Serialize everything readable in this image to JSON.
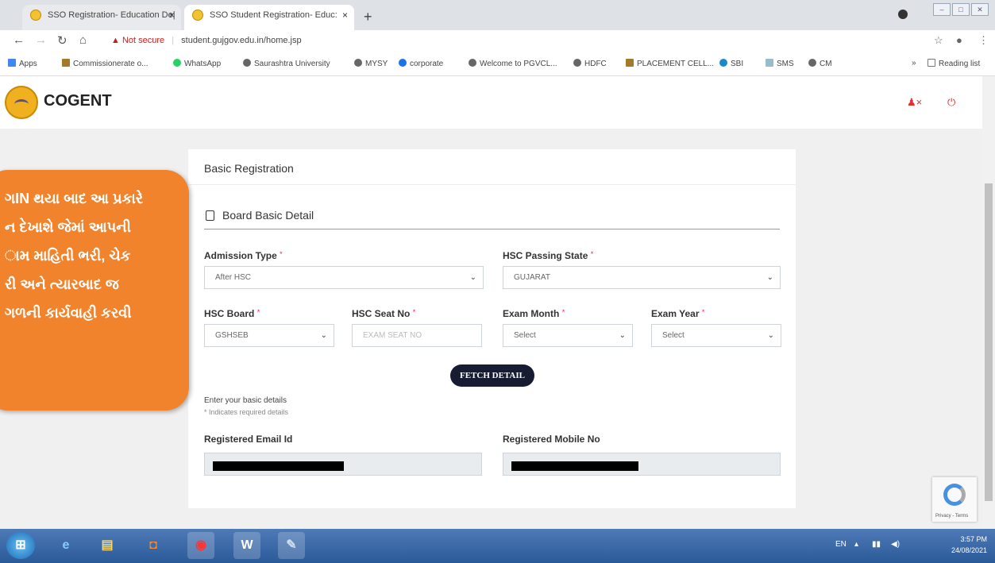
{
  "browser": {
    "tabs": [
      {
        "title": "SSO Registration- Education De|"
      },
      {
        "title": "SSO Student Registration- Educ:"
      }
    ],
    "new_tab": "+",
    "not_secure": "Not secure",
    "url": "student.gujgov.edu.in/home.jsp",
    "bookmarks": [
      "Apps",
      "Commissionerate o...",
      "WhatsApp",
      "Saurashtra University",
      "MYSY",
      "corporate",
      "Welcome to PGVCL...",
      "HDFC",
      "PLACEMENT CELL...",
      "SBI",
      "SMS",
      "CM"
    ],
    "reading_list": "Reading list",
    "more": "»"
  },
  "header": {
    "brand": "COGENT"
  },
  "form": {
    "card_title": "Basic Registration",
    "section_title": "Board Basic Detail",
    "fields": {
      "admission_type": {
        "label": "Admission Type",
        "value": "After HSC"
      },
      "hsc_passing_state": {
        "label": "HSC Passing State",
        "value": "GUJARAT"
      },
      "hsc_board": {
        "label": "HSC Board",
        "value": "GSHSEB"
      },
      "hsc_seat_no": {
        "label": "HSC Seat No",
        "placeholder": "EXAM SEAT NO"
      },
      "exam_month": {
        "label": "Exam Month",
        "value": "Select"
      },
      "exam_year": {
        "label": "Exam Year",
        "value": "Select"
      }
    },
    "required_mark": "*",
    "fetch_button": "FETCH DETAIL",
    "note_details": "Enter your basic details",
    "note_required": "* Indicates required details",
    "registered_email_label": "Registered Email Id",
    "registered_mobile_label": "Registered Mobile No"
  },
  "overlay": {
    "lines": [
      "ગIN થયા બાદ આ પ્રકારે",
      "ન દેખાશે જેમાં આપની",
      "ામ માહિતી ભરી, ચેક",
      "રી અને ત્યારબાદ જ",
      "ગળની કાર્યવાહી કરવી"
    ]
  },
  "recaptcha": {
    "text": "Privacy - Terms"
  },
  "taskbar": {
    "lang": "EN",
    "time": "3:57 PM",
    "date": "24/08/2021"
  },
  "colors": {
    "overlay": "#f0832c",
    "fetch_button": "#171c33",
    "required": "#e22255",
    "taskbar": "#2b5a99"
  }
}
